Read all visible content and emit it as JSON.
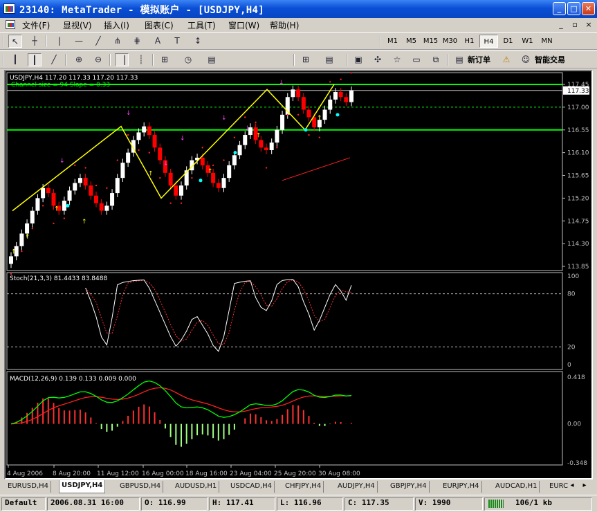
{
  "window": {
    "title": "23140: MetaTrader - 模拟账户 - [USDJPY,H4]",
    "btn_minimize": "_",
    "btn_maximize": "□",
    "btn_close": "✕"
  },
  "menu": {
    "items": [
      "文件(F)",
      "显视(V)",
      "插入(I)",
      "图表(C)",
      "工具(T)",
      "窗口(W)",
      "帮助(H)"
    ],
    "mdi_controls": [
      "_",
      "▫",
      "×"
    ]
  },
  "toolbar1": {
    "icons": [
      "cursor-arrow-icon",
      "crosshair-icon",
      "vertical-line-icon",
      "horizontal-line-icon",
      "trendline-icon",
      "fibonacci-icon",
      "channel-icon",
      "text-icon",
      "label-icon",
      "arrow-dropdown-icon"
    ],
    "glyphs": [
      "↖",
      "┼",
      "|",
      "—",
      "╱",
      "⋕",
      "⋔",
      "A",
      "T",
      "↕"
    ],
    "timeframes": [
      "M1",
      "M5",
      "M15",
      "M30",
      "H1",
      "H4",
      "D1",
      "W1",
      "MN"
    ],
    "active_timeframe": "H4"
  },
  "toolbar2": {
    "glyphs": [
      "┃",
      "┃",
      "╱",
      "⊕",
      "⊖",
      "▕",
      "┊",
      "⊞",
      "◷",
      "▤",
      "⊞",
      "▤",
      "▣",
      "✣",
      "☆",
      "▭",
      "⧉",
      "▤",
      "⚠",
      "☺"
    ],
    "new_order_label": "新订单",
    "expert_label": "智能交易"
  },
  "chart": {
    "main_caption": "USDJPY,H4  117.20 117.33 117.20 117.33",
    "channel_text": "Channel size = 94 Slope = 0.33",
    "price_ticks": [
      "117.45",
      "117.00",
      "116.55",
      "116.10",
      "115.65",
      "115.20",
      "114.75",
      "114.30",
      "113.85"
    ],
    "current_price": "117.33",
    "stoch_caption": "Stoch(21,3,3) 81.4433 83.8488",
    "stoch_ticks": [
      "100",
      "80",
      "20",
      "0"
    ],
    "macd_caption": "MACD(12,26,9) 0.139 0.133 0.009 0.000",
    "macd_ticks": [
      "0.418",
      "0.00",
      "-0.348"
    ],
    "time_ticks": [
      "4 Aug 2006",
      "8 Aug 20:00",
      "11 Aug 12:00",
      "16 Aug 00:00",
      "18 Aug 16:00",
      "23 Aug 04:00",
      "25 Aug 20:00",
      "30 Aug 08:00"
    ],
    "colors": {
      "background": "#000000",
      "bull_candle": "#ffffff",
      "bear_candle": "#ff0000",
      "channel": "#00ff00",
      "zigzag": "#ffff00",
      "sar": "#ff2020",
      "stoch_main": "#ffffff",
      "stoch_signal": "#ff3030",
      "macd_main": "#00ff00",
      "macd_signal": "#ff2020",
      "hist_up": "#ff3030",
      "hist_down": "#a0ff80",
      "arrow_down": "#ff40ff",
      "arrow_up": "#ffff00",
      "dot_cyan": "#00ffff"
    }
  },
  "tabs": {
    "items": [
      "EURUSD,H4",
      "USDJPY,H4",
      "GBPUSD,H4",
      "AUDUSD,H1",
      "USDCAD,H4",
      "CHFJPY,H4",
      "AUDJPY,H4",
      "GBPJPY,H4",
      "EURJPY,H4",
      "AUDCAD,H1",
      "EURC"
    ],
    "active": "USDJPY,H4",
    "nav_left": "◂",
    "nav_right": "▸"
  },
  "status": {
    "profile": "Default",
    "datetime": "2006.08.31 16:00",
    "open": "O: 116.99",
    "high": "H: 117.41",
    "low": "L: 116.96",
    "close": "C: 117.35",
    "volume": "V: 1990",
    "traffic": "106/1 kb"
  },
  "chart_data": {
    "type": "candlestick",
    "symbol": "USDJPY",
    "timeframe": "H4",
    "last_bar": {
      "open": 117.2,
      "high": 117.33,
      "low": 117.2,
      "close": 117.33
    },
    "ylim_price": [
      113.85,
      117.45
    ],
    "channel": {
      "upper": 117.45,
      "lower": 116.55,
      "size": 94,
      "slope": 0.33
    },
    "zigzag": [
      [
        114.98,
        116.62
      ],
      [
        116.63,
        115.22
      ],
      [
        117.35,
        115.0
      ],
      [
        116.55,
        115.6
      ],
      [
        117.45,
        116.5
      ]
    ],
    "close_series": [
      114.05,
      114.25,
      114.5,
      114.7,
      114.95,
      115.2,
      115.4,
      115.3,
      115.05,
      114.95,
      115.15,
      115.35,
      115.5,
      115.6,
      115.45,
      115.25,
      115.1,
      114.95,
      115.05,
      115.3,
      115.6,
      115.9,
      116.1,
      116.35,
      116.5,
      116.62,
      116.45,
      116.2,
      115.95,
      115.7,
      115.45,
      115.25,
      115.45,
      115.75,
      115.95,
      116.0,
      115.85,
      115.7,
      115.5,
      115.4,
      115.6,
      115.85,
      116.05,
      116.25,
      116.45,
      116.6,
      116.35,
      116.2,
      116.15,
      116.3,
      116.55,
      116.85,
      117.2,
      117.35,
      117.2,
      116.95,
      116.8,
      116.6,
      116.75,
      116.95,
      117.15,
      117.3,
      117.2,
      117.1,
      117.33
    ],
    "stochastic": {
      "k": 81.4433,
      "d": 83.8488,
      "levels": [
        20,
        80
      ],
      "ylim": [
        0,
        100
      ]
    },
    "macd": {
      "main": 0.139,
      "signal": 0.133,
      "histogram": 0.009,
      "ylim": [
        -0.348,
        0.418
      ]
    }
  }
}
